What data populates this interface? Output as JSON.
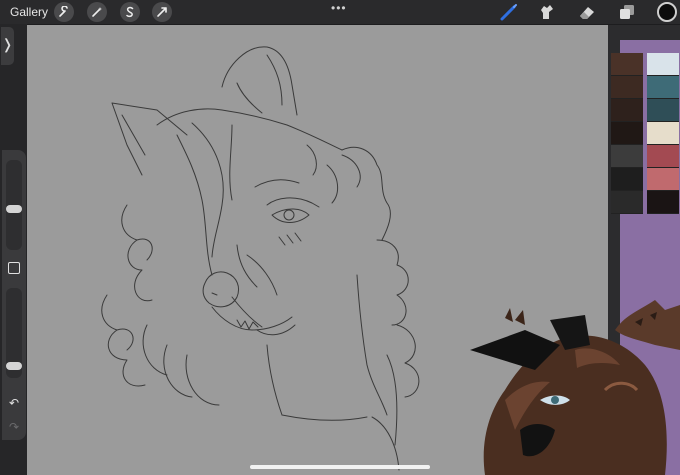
{
  "topbar": {
    "gallery_label": "Gallery",
    "left_tools": [
      "wrench-icon",
      "magic-wand-icon",
      "selection-icon",
      "transform-icon"
    ],
    "more_label": "•••",
    "right_tools": [
      "brush-icon",
      "smudge-icon",
      "eraser-icon",
      "layers-icon"
    ],
    "current_color": "#0c0c0c",
    "accent_color": "#2f6fe0"
  },
  "sidebar": {
    "toggle_glyph": "❭",
    "brush_size": 0.45,
    "opacity": 0.1,
    "modify_button": "square-icon",
    "undo_glyph": "↶",
    "redo_glyph": "↷"
  },
  "canvas": {
    "background": "#9b9b9b",
    "stroke_color": "#3a3a3a"
  },
  "reference": {
    "background": "#8a6fa3",
    "palette_left": [
      "#4a3228",
      "#3d2a22",
      "#2e211c",
      "#201815",
      "#3c3c3c",
      "#1e1e1e",
      "#2a2a2a"
    ],
    "palette_right": [
      "#d9e3ea",
      "#3e6b77",
      "#2f4e57",
      "#e6ddcb",
      "#a34a52",
      "#c06a6e",
      "#1a1414"
    ]
  }
}
